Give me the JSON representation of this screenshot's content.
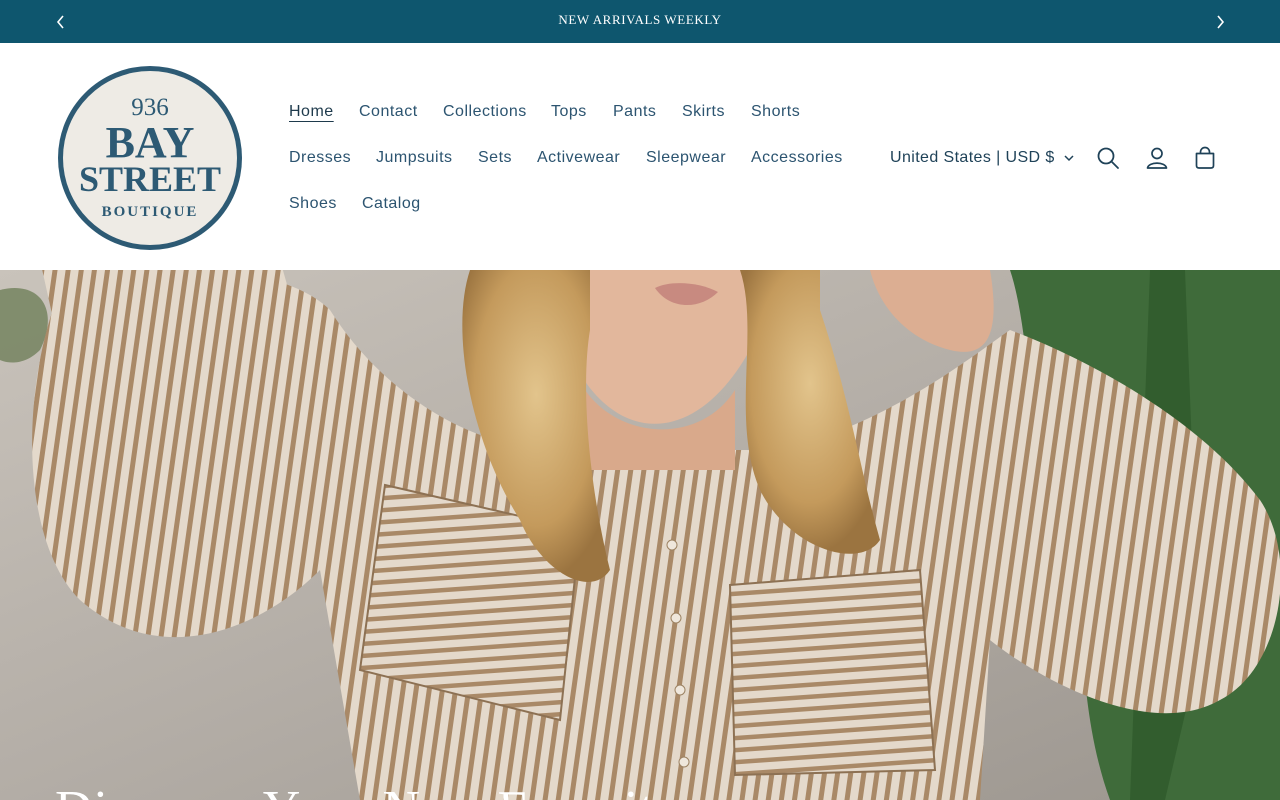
{
  "announcement": {
    "text": "NEW ARRIVALS WEEKLY"
  },
  "logo": {
    "line1": "936",
    "line2": "BAY",
    "line3": "STREET",
    "line4": "BOUTIQUE"
  },
  "nav": {
    "home": "Home",
    "contact": "Contact",
    "collections": "Collections",
    "tops": "Tops",
    "pants": "Pants",
    "skirts": "Skirts",
    "shorts": "Shorts",
    "dresses": "Dresses",
    "jumpsuits": "Jumpsuits",
    "sets": "Sets",
    "activewear": "Activewear",
    "sleepwear": "Sleepwear",
    "accessories": "Accessories",
    "shoes": "Shoes",
    "catalog": "Catalog"
  },
  "localization": {
    "country_currency": "United States | USD $"
  },
  "icons": {
    "search": "search-icon",
    "account": "account-icon",
    "cart": "cart-icon",
    "prev": "chevron-left-icon",
    "next": "chevron-right-icon"
  },
  "hero": {
    "heading": "Discover Your New Favorites"
  },
  "colors": {
    "brand": "#0e566e",
    "nav_text": "#2c5470",
    "logo_ring": "#2d5a74",
    "logo_fill": "#eeebe5"
  }
}
